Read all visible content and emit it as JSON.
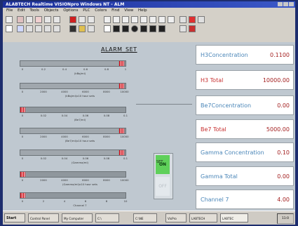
{
  "window": {
    "title": "ALABTECH Realtime VISIONpro Windows NT - ALM"
  },
  "menu": [
    "File",
    "Edit",
    "Tools",
    "Objects",
    "Options",
    "PLC",
    "Colors",
    "Find",
    "View",
    "Help"
  ],
  "alarm_set": {
    "title": "ALARM_SET",
    "bars": [
      {
        "label": "(kBq/ml)",
        "ticks": [
          "0",
          "0.2",
          "0.4",
          "0.6",
          "0.8",
          "1"
        ],
        "marker": 0.96
      },
      {
        "label": "(kBq/ml)x10 hour sets",
        "ticks": [
          "0",
          "2000",
          "4000",
          "6000",
          "8000",
          "10000"
        ],
        "marker": 0.96
      },
      {
        "label": "(Be7/ml)",
        "ticks": [
          "0",
          "0.02",
          "0.04",
          "0.06",
          "0.08",
          "0.1"
        ],
        "marker": 0.02
      },
      {
        "label": "(Be7/ml)x10 hour sets",
        "ticks": [
          "0",
          "2000",
          "4000",
          "6000",
          "8000",
          "10000"
        ],
        "marker": 0.96
      },
      {
        "label": "(Gamma/ml)",
        "ticks": [
          "0",
          "0.02",
          "0.04",
          "0.06",
          "0.08",
          "0.1"
        ],
        "marker": 0.96
      },
      {
        "label": "(Gamma/ml)x10 hour sets",
        "ticks": [
          "0",
          "2000",
          "4000",
          "6000",
          "8000",
          "10000"
        ],
        "marker": 0.02
      },
      {
        "label": "Channel 7",
        "ticks": [
          "0",
          "2",
          "4",
          "6",
          "8",
          "10"
        ],
        "marker": 0.02
      }
    ]
  },
  "toggle": {
    "on_label": "ON",
    "off_label": "OFF",
    "set_label": "SET"
  },
  "readouts": [
    {
      "label": "H3Concentration",
      "value": "0.1100"
    },
    {
      "label": "H3 Total",
      "value": "10000.00"
    },
    {
      "label": "Be7Concentration",
      "value": "0.00"
    },
    {
      "label": "Be7 Total",
      "value": "5000.00"
    },
    {
      "label": "Gamma Concentration",
      "value": "0.10"
    },
    {
      "label": "Gamma Total",
      "value": "0.00"
    },
    {
      "label": "Channel 7",
      "value": "4.00"
    }
  ],
  "taskbar": {
    "start": "Start",
    "items": [
      "Control Panel",
      "My Computer",
      "C:\\",
      "C:\\NE",
      "VisPro",
      "LABTECH",
      "LABTEC"
    ],
    "clock": "11:0"
  },
  "colors": {
    "accent_red": "#d8202a",
    "toggle_on": "#5fd05a",
    "title_blue": "#1b2f9a"
  }
}
